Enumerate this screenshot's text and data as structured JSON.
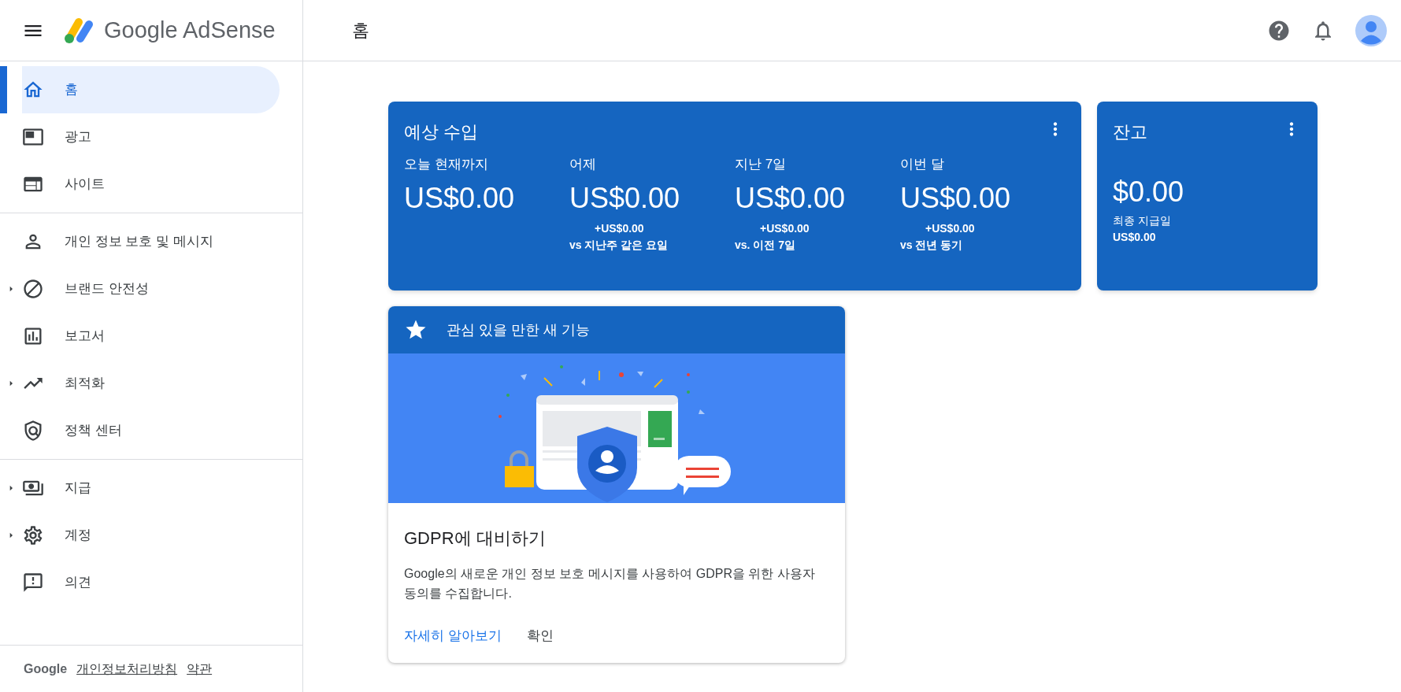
{
  "header": {
    "product": "Google AdSense",
    "page_title": "홈"
  },
  "sidebar": {
    "sections": [
      [
        {
          "label": "홈",
          "selected": true,
          "expandable": false
        },
        {
          "label": "광고",
          "selected": false,
          "expandable": false
        },
        {
          "label": "사이트",
          "selected": false,
          "expandable": false
        }
      ],
      [
        {
          "label": "개인 정보 보호 및 메시지",
          "selected": false,
          "expandable": false
        },
        {
          "label": "브랜드 안전성",
          "selected": false,
          "expandable": true
        },
        {
          "label": "보고서",
          "selected": false,
          "expandable": false
        },
        {
          "label": "최적화",
          "selected": false,
          "expandable": true
        },
        {
          "label": "정책 센터",
          "selected": false,
          "expandable": false
        }
      ],
      [
        {
          "label": "지급",
          "selected": false,
          "expandable": true
        },
        {
          "label": "계정",
          "selected": false,
          "expandable": true
        },
        {
          "label": "의견",
          "selected": false,
          "expandable": false
        }
      ]
    ],
    "footer": {
      "brand": "Google",
      "links": [
        "개인정보처리방침",
        "약관"
      ]
    }
  },
  "earnings": {
    "title": "예상 수입",
    "metrics": [
      {
        "label": "오늘 현재까지",
        "value": "US$0.00"
      },
      {
        "label": "어제",
        "value": "US$0.00",
        "change": "+US$0.00",
        "comparison": "vs 지난주 같은 요일"
      },
      {
        "label": "지난 7일",
        "value": "US$0.00",
        "change": "+US$0.00",
        "comparison": "vs. 이전 7일"
      },
      {
        "label": "이번 달",
        "value": "US$0.00",
        "change": "+US$0.00",
        "comparison": "vs 전년 동기"
      }
    ]
  },
  "balance": {
    "title": "잔고",
    "value": "$0.00",
    "last_payment_label": "최종 지급일",
    "last_payment_value": "US$0.00"
  },
  "feature_card": {
    "header": "관심 있을 만한 새 기능",
    "title": "GDPR에 대비하기",
    "body": "Google의 새로운 개인 정보 보호 메시지를 사용하여 GDPR을 위한 사용자 동의를 수집합니다.",
    "actions": [
      "자세히 알아보기",
      "확인"
    ]
  }
}
